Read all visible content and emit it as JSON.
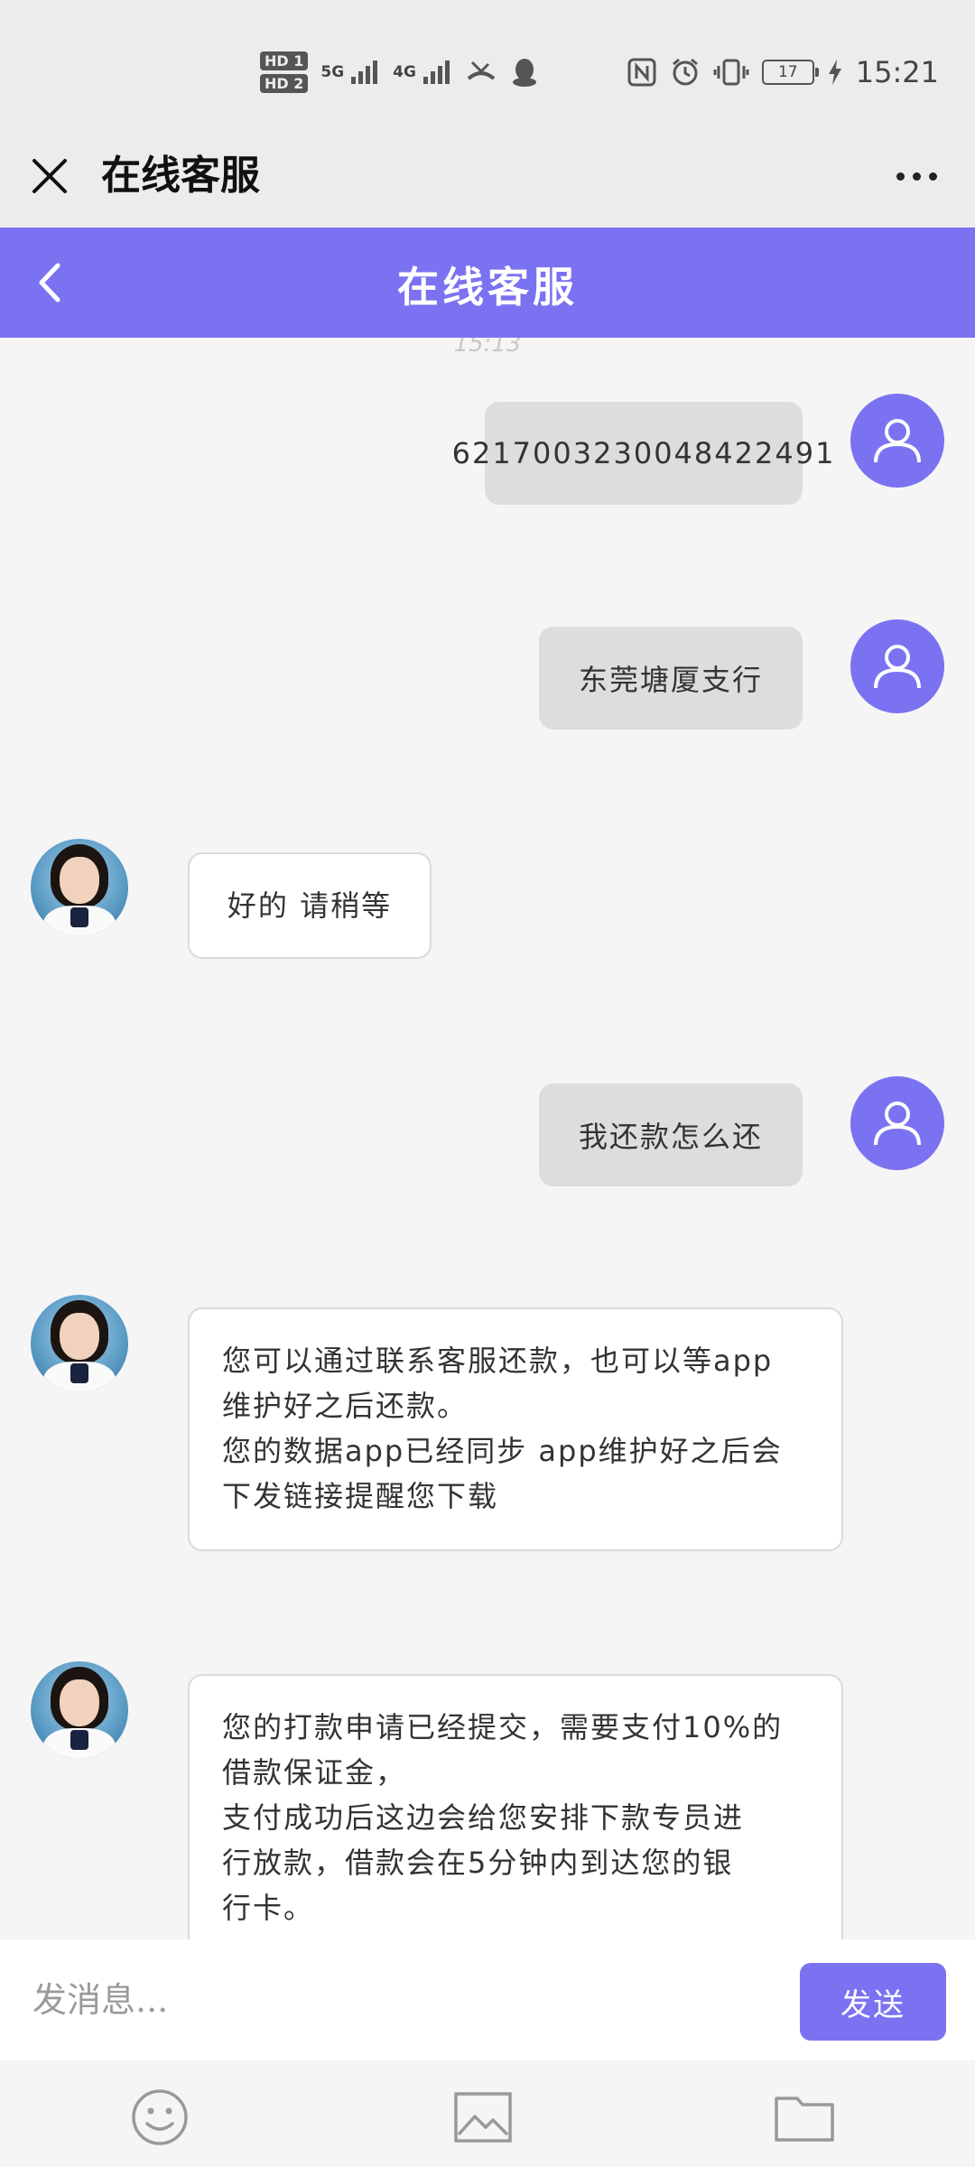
{
  "status_bar": {
    "hd1": "HD 1",
    "hd2": "HD 2",
    "network1": "5G",
    "network2": "4G",
    "battery": "17",
    "time": "15:21"
  },
  "window": {
    "title": "在线客服"
  },
  "header": {
    "title": "在线客服"
  },
  "chat": {
    "timestamp": "15:13",
    "messages": [
      {
        "sender": "user",
        "text": "6217003230048422491"
      },
      {
        "sender": "user",
        "text": "东莞塘厦支行"
      },
      {
        "sender": "agent",
        "text": "好的 请稍等"
      },
      {
        "sender": "user",
        "text": "我还款怎么还"
      },
      {
        "sender": "agent",
        "lines": [
          "您可以通过联系客服还款，也可以等app",
          "维护好之后还款。",
          "您的数据app已经同步 app维护好之后会",
          "下发链接提醒您下载"
        ]
      },
      {
        "sender": "agent",
        "lines": [
          "您的打款申请已经提交，需要支付10%的",
          "借款保证金，",
          "支付成功后这边会给您安排下款专员进",
          "行放款，借款会在5分钟内到达您的银",
          "行卡。"
        ]
      }
    ]
  },
  "input": {
    "placeholder": "发消息...",
    "send_label": "发送"
  },
  "colors": {
    "accent": "#7b72f2",
    "user_bubble": "#dddddd",
    "agent_bubble": "#ffffff",
    "background": "#f5f5f5"
  },
  "icons": [
    "close-icon",
    "more-icon",
    "back-icon",
    "user-avatar-icon",
    "emoji-icon",
    "image-icon",
    "folder-icon"
  ]
}
